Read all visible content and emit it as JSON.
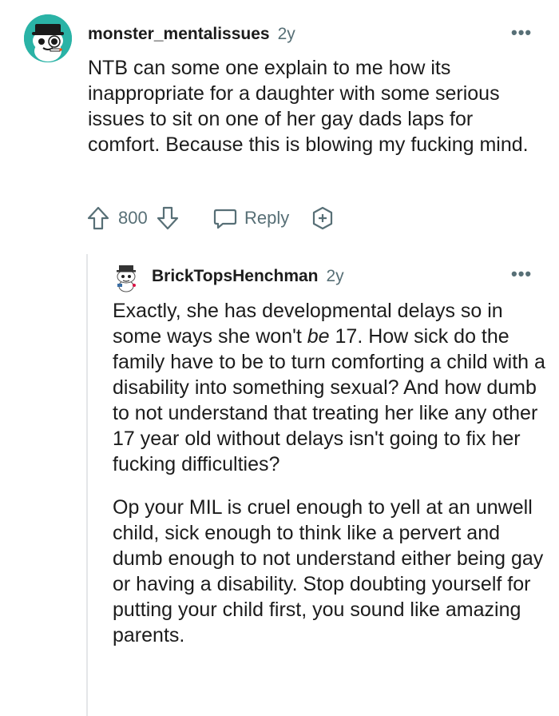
{
  "comment": {
    "username": "monster_mentalissues",
    "age": "2y",
    "text": "NTB can some one explain to me how its inappropriate for a daughter with some serious issues to sit on one of her gay dads laps for comfort. Because this is blowing my fucking mind.",
    "votes": "800",
    "reply_label": "Reply",
    "avatar_icon": "snoo-avatar-icon",
    "avatar_color": "#2ab3a6"
  },
  "reply": {
    "username": "BrickTopsHenchman",
    "age": "2y",
    "para1_before": "Exactly, she has developmental delays so in some ways she won't ",
    "para1_em": "be",
    "para1_after": " 17. How sick do the family have to be to turn comforting a child with a disability into something sexual? And how dumb to not understand that treating her like any other 17 year old without delays isn't going to fix her fucking difficulties?",
    "para2": "Op your MIL is cruel enough to yell at an unwell child, sick enough to think like a pervert and dumb enough to not understand either being gay or having a disability. Stop doubting yourself for putting your child first, you sound like amazing parents.",
    "avatar_icon": "snoo-avatar-icon"
  },
  "ui": {
    "more_glyph": "•••",
    "text_color": "#1c1c1c",
    "meta_color": "#576f76"
  }
}
